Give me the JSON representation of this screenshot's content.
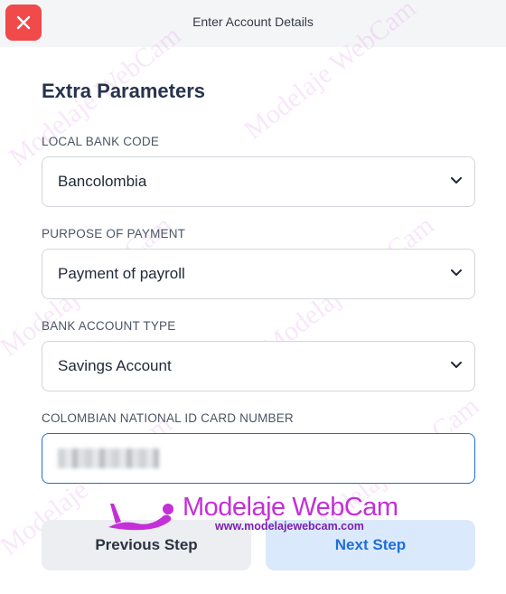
{
  "header": {
    "title": "Enter Account Details",
    "close_icon": "close-icon",
    "close_color": "#f04a4a"
  },
  "section_title": "Extra Parameters",
  "fields": {
    "local_bank_code": {
      "label": "LOCAL BANK CODE",
      "value": "Bancolombia"
    },
    "purpose_of_payment": {
      "label": "PURPOSE OF PAYMENT",
      "value": "Payment of payroll"
    },
    "bank_account_type": {
      "label": "BANK ACCOUNT TYPE",
      "value": "Savings Account"
    },
    "national_id": {
      "label": "COLOMBIAN NATIONAL ID CARD NUMBER",
      "value": ""
    }
  },
  "buttons": {
    "previous": "Previous Step",
    "next": "Next Step"
  },
  "watermark": {
    "brand": "Modelaje WebCam",
    "url": "www.modelajewebcam.com",
    "color": "#c42fd8"
  },
  "colors": {
    "accent": "#1e6fd9",
    "next_bg": "#dbe9fd",
    "prev_bg": "#eceef1"
  }
}
